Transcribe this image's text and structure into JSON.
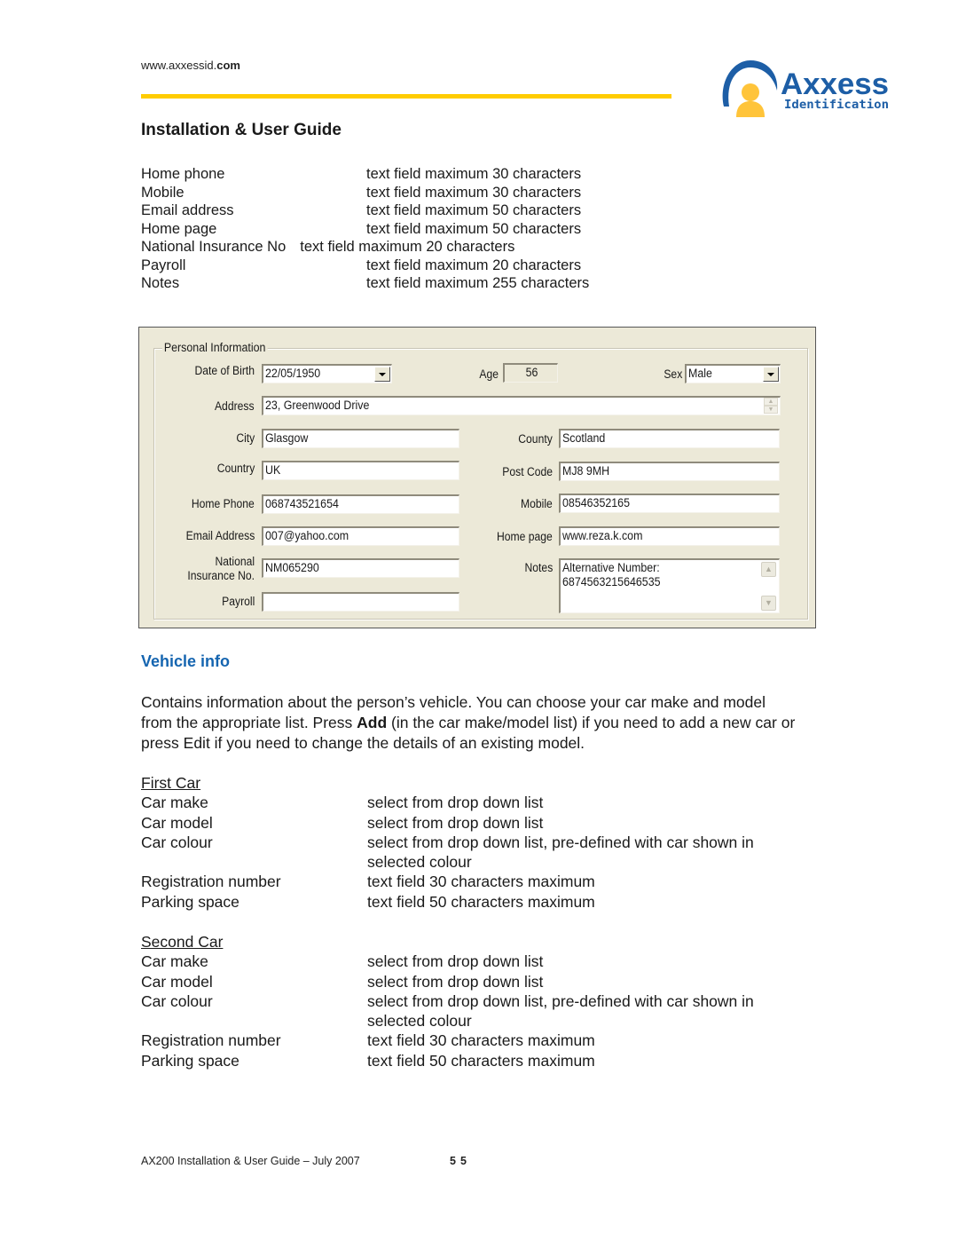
{
  "header": {
    "url_prefix": "www.axxessid.",
    "url_suffix": "com",
    "logo": {
      "name": "Axxess",
      "tagline": "Identification",
      "colors": {
        "blue": "#1d5ea6",
        "yellow": "#ffc43a"
      }
    },
    "rule_color": "#ffcc00",
    "title": "Installation & User Guide"
  },
  "field_specs": [
    {
      "label": "Home phone",
      "desc": "text field maximum 30 characters"
    },
    {
      "label": "Mobile",
      "desc": "text field maximum 30 characters"
    },
    {
      "label": "Email address",
      "desc": "text field maximum 50 characters"
    },
    {
      "label": "Home page",
      "desc": "text field maximum 50 characters"
    },
    {
      "label": "National Insurance No",
      "desc": "text field maximum 20 characters"
    },
    {
      "label": "Payroll",
      "desc": "text field maximum 20 characters"
    },
    {
      "label": "Notes",
      "desc": "text field maximum 255 characters"
    }
  ],
  "dialog": {
    "group_title": "Personal Information",
    "date_of_birth": {
      "label": "Date of Birth",
      "value": "22/05/1950"
    },
    "age": {
      "label": "Age",
      "value": "56"
    },
    "sex": {
      "label": "Sex",
      "value": "Male"
    },
    "address": {
      "label": "Address",
      "value": "23, Greenwood Drive"
    },
    "city": {
      "label": "City",
      "value": "Glasgow"
    },
    "county": {
      "label": "County",
      "value": "Scotland"
    },
    "country": {
      "label": "Country",
      "value": "UK"
    },
    "post_code": {
      "label": "Post Code",
      "value": "MJ8 9MH"
    },
    "home_phone": {
      "label": "Home Phone",
      "value": "068743521654"
    },
    "mobile": {
      "label": "Mobile",
      "value": "08546352165"
    },
    "email": {
      "label": "Email Address",
      "value": "007@yahoo.com"
    },
    "home_page": {
      "label": "Home page",
      "value": "www.reza.k.com"
    },
    "national_insurance": {
      "label_line1": "National",
      "label_line2": "Insurance No.",
      "value": "NM065290"
    },
    "notes": {
      "label": "Notes",
      "value": "Alternative Number:\n6874563215646535"
    },
    "payroll": {
      "label": "Payroll",
      "value": ""
    }
  },
  "vehicle": {
    "heading": "Vehicle info",
    "heading_color": "#1565b0",
    "para_part1": "Contains information about the person’s vehicle. You can choose your car make and model from the appropriate list. Press ",
    "para_bold": "Add",
    "para_part2": " (in the car make/model list) if you need to add a new car or press Edit if you need to change the details of an existing model.",
    "cars": [
      {
        "heading": "First Car",
        "rows": [
          {
            "label": "Car make",
            "desc": "select from drop down list"
          },
          {
            "label": "Car model",
            "desc": "select from drop down list"
          },
          {
            "label": "Car colour",
            "desc": "select from drop down list, pre-defined with car shown in selected colour"
          },
          {
            "label": "Registration number",
            "desc": "text field 30 characters maximum"
          },
          {
            "label": "Parking space",
            "desc": "text field 50 characters maximum"
          }
        ]
      },
      {
        "heading": "Second Car",
        "rows": [
          {
            "label": "Car make",
            "desc": "select from drop down list"
          },
          {
            "label": "Car model",
            "desc": "select from drop down list"
          },
          {
            "label": "Car colour",
            "desc": "select from drop down list, pre-defined with car shown in selected colour"
          },
          {
            "label": "Registration number",
            "desc": "text field 30 characters maximum"
          },
          {
            "label": "Parking space",
            "desc": "text field 50 characters maximum"
          }
        ]
      }
    ]
  },
  "footer": {
    "text": "AX200 Installation & User Guide – July 2007",
    "page_number": "55"
  }
}
